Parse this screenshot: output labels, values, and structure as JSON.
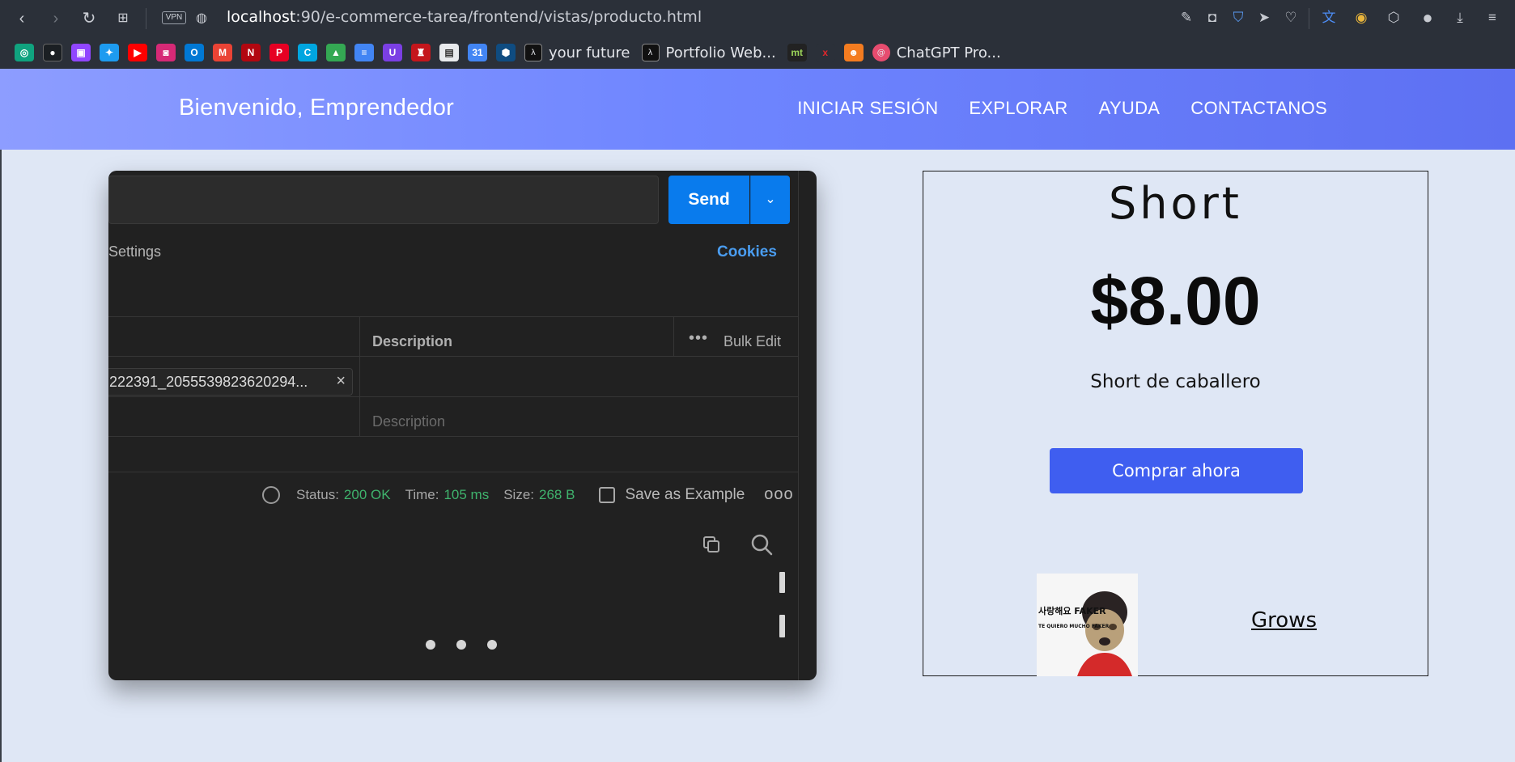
{
  "browser": {
    "url_host": "localhost",
    "url_path": ":90/e-commerce-tarea/frontend/vistas/producto.html",
    "vpn_label": "VPN",
    "bookmarks_text": [
      "your future",
      "Portfolio Web...",
      "ChatGPT Pro..."
    ]
  },
  "header": {
    "title": "Bienvenido, Emprendedor",
    "nav": [
      "INICIAR SESIÓN",
      "EXPLORAR",
      "AYUDA",
      "CONTACTANOS"
    ]
  },
  "postman": {
    "send_label": "Send",
    "settings_label": "Settings",
    "cookies_label": "Cookies",
    "description_header": "Description",
    "bulk_edit_label": "Bulk Edit",
    "chip_value": "222391_2055539823620294...",
    "description_placeholder": "Description",
    "status_label": "Status:",
    "status_value": "200 OK",
    "time_label": "Time:",
    "time_value": "105 ms",
    "size_label": "Size:",
    "size_value": "268 B",
    "save_example_label": "Save as Example"
  },
  "product": {
    "name": "Short",
    "price": "$8.00",
    "description": "Short de caballero",
    "buy_label": "Comprar ahora",
    "thumb_text_1": "사랑해요 FAKER",
    "thumb_text_2": "TE QUIERO MUCHO FAKER",
    "link_label": "Grows"
  },
  "colors": {
    "header_start": "#8d9dff",
    "header_end": "#5d70f2",
    "buy_button": "#3f5ef0",
    "send_button": "#097bed",
    "status_green": "#3fb36d"
  }
}
